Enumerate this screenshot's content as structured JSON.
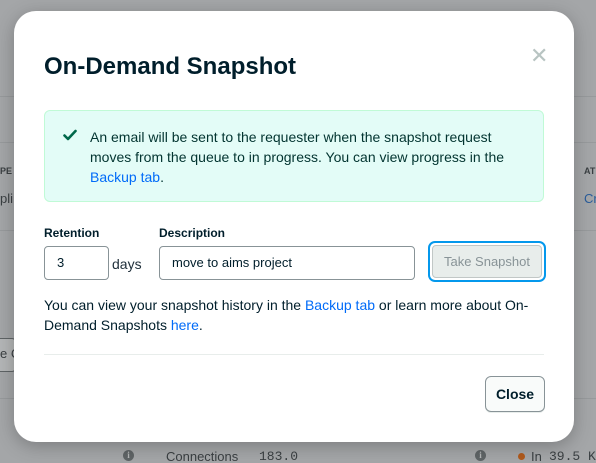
{
  "background": {
    "left_fragment_1": "PE",
    "left_fragment_2": "pli",
    "left_button_fragment": "e C",
    "right_fragment_1": "AT",
    "right_fragment_2": "Cr",
    "footer_connections_label": "Connections",
    "footer_connections_value": "183.0",
    "footer_in_label": "In",
    "footer_in_value": "39.5 K"
  },
  "modal": {
    "title": "On-Demand Snapshot",
    "close_icon": "close-icon",
    "alert": {
      "icon": "checkmark-icon",
      "text": "An email will be sent to the requester when the snapshot request moves from the queue to in progress. You can view progress in the ",
      "link": "Backup tab",
      "suffix": "."
    },
    "retention": {
      "label": "Retention",
      "value": "3",
      "unit": "days"
    },
    "description": {
      "label": "Description",
      "value": "move to aims project"
    },
    "take_snapshot_label": "Take Snapshot",
    "info": {
      "part1": "You can view your snapshot history in the ",
      "link1": "Backup tab",
      "part2": " or learn more about On-Demand Snapshots ",
      "link2": "here",
      "part3": "."
    },
    "close_label": "Close"
  },
  "colors": {
    "accent_link": "#016bf8",
    "alert_bg": "#e3fcf7",
    "check_green": "#00684a",
    "focus_ring": "#0498ec"
  }
}
